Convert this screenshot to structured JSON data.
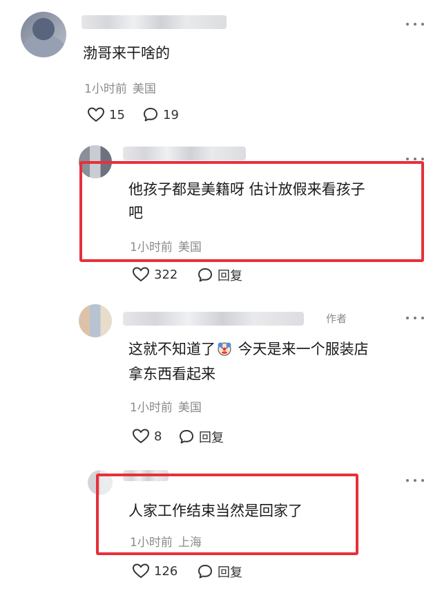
{
  "comments": [
    {
      "text": "渤哥来干啥的",
      "time": "1小时前",
      "location": "美国",
      "likes": "15",
      "replies": "19"
    },
    {
      "text_line1": "他孩子都是美籍呀 估计放假来看孩子",
      "text_line2": "吧",
      "time": "1小时前",
      "location": "美国",
      "likes": "322",
      "reply_label": "回复"
    },
    {
      "author_tag": "作者",
      "text_line1_a": "这就不知道了",
      "text_line1_b": " 今天是来一个服装店",
      "text_line2": "拿东西看起来",
      "time": "1小时前",
      "location": "美国",
      "likes": "8",
      "reply_label": "回复",
      "emoji": "clown-face-emoji"
    },
    {
      "text": "人家工作结束当然是回家了",
      "time": "1小时前",
      "location": "上海",
      "likes": "126",
      "reply_label": "回复"
    }
  ],
  "icons": {
    "like": "heart-outline-icon",
    "reply": "speech-bubble-icon",
    "more": "more-dots-icon"
  },
  "colors": {
    "highlight_box": "#e6303a",
    "meta_text": "#8a8a8a",
    "main_text": "#1a1a1a"
  }
}
